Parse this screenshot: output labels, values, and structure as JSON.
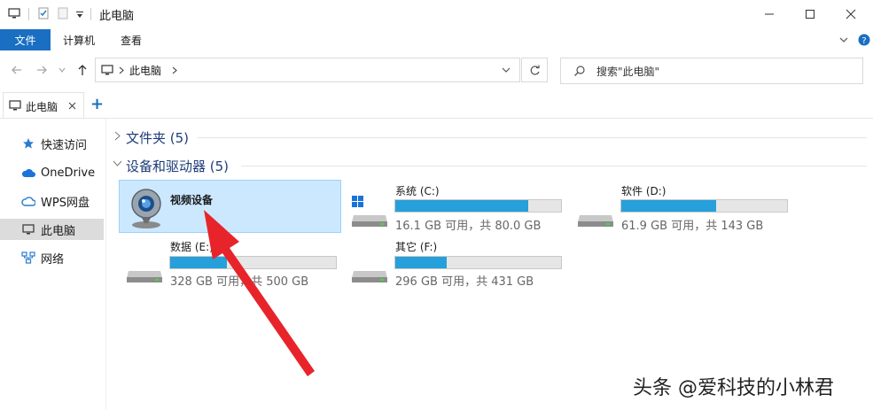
{
  "window": {
    "title": "此电脑"
  },
  "ribbon": {
    "file_tab": "文件",
    "tabs": [
      "计算机",
      "查看"
    ]
  },
  "address": {
    "location": "此电脑",
    "search_placeholder": "搜索\"此电脑\""
  },
  "doc_tab": {
    "label": "此电脑",
    "add_symbol": "+"
  },
  "sidebar": {
    "items": [
      {
        "label": "快速访问",
        "icon": "star-icon"
      },
      {
        "label": "OneDrive",
        "icon": "cloud-icon"
      },
      {
        "label": "WPS网盘",
        "icon": "wps-cloud-icon"
      },
      {
        "label": "此电脑",
        "icon": "computer-icon"
      },
      {
        "label": "网络",
        "icon": "network-icon"
      }
    ]
  },
  "groups": {
    "folders": "文件夹 (5)",
    "devices": "设备和驱动器 (5)"
  },
  "devices": {
    "camera": {
      "label": "视频设备"
    },
    "drives": [
      {
        "name": "系统 (C:)",
        "info": "16.1 GB 可用，共 80.0 GB",
        "used_fraction": 0.8
      },
      {
        "name": "软件 (D:)",
        "info": "61.9 GB 可用，共 143 GB",
        "used_fraction": 0.57
      },
      {
        "name": "数据 (E:)",
        "info": "328 GB 可用，共 500 GB",
        "used_fraction": 0.34
      },
      {
        "name": "其它 (F:)",
        "info": "296 GB 可用，共 431 GB",
        "used_fraction": 0.31
      }
    ]
  },
  "watermark": "头条 @爱科技的小林君",
  "colors": {
    "accent": "#1a6fc2",
    "bar_fill": "#26a0da",
    "selection": "#cce8ff",
    "arrow": "#e8242b"
  }
}
